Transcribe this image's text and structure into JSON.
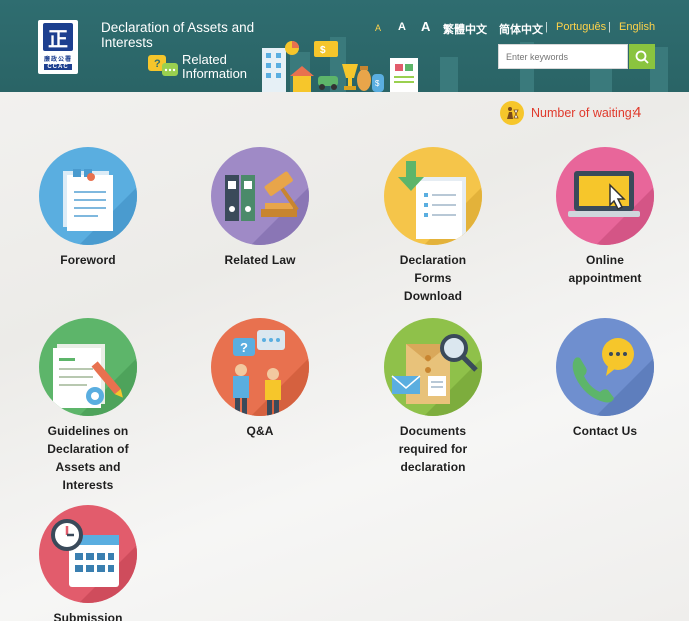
{
  "header": {
    "title": "Declaration of Assets and Interests",
    "related": "Related Information",
    "logo": {
      "cn": "廉政公署",
      "en": "CCAC",
      "mark": "正"
    },
    "font_sizes": [
      "A",
      "A",
      "A"
    ],
    "languages": {
      "traditional_chinese": "繁體中文",
      "simplified_chinese": "简体中文",
      "portuguese": "Português",
      "english": "English",
      "separator": "|"
    },
    "search_placeholder": "Enter keywords",
    "colors": {
      "header_bg": "#2f6d70",
      "accent_yellow": "#ffd34a",
      "search_button": "#8ac43f"
    }
  },
  "waiting": {
    "label": "Number of waiting:",
    "count": "4",
    "color": "#e03a2c"
  },
  "tiles": [
    {
      "label": "Foreword",
      "icon": "document-icon",
      "color": "#5aaee0"
    },
    {
      "label": "Related Law",
      "icon": "gavel-binders-icon",
      "color": "#9f8ac6"
    },
    {
      "label": "Declaration Forms Download",
      "icon": "download-forms-icon",
      "color": "#f5c54a"
    },
    {
      "label": "Online appointment",
      "icon": "laptop-click-icon",
      "color": "#e8669a"
    },
    {
      "label": "Guidelines on Declaration of Assets and Interests",
      "icon": "guideline-document-icon",
      "color": "#5db56a"
    },
    {
      "label": "Q&A",
      "icon": "qa-people-icon",
      "color": "#e8714f"
    },
    {
      "label": "Documents required for declaration",
      "icon": "envelope-search-icon",
      "color": "#8fc14a"
    },
    {
      "label": "Contact Us",
      "icon": "phone-chat-icon",
      "color": "#6f8fcf"
    },
    {
      "label": "Submission",
      "icon": "calendar-clock-icon",
      "color": "#e25c6c"
    }
  ]
}
